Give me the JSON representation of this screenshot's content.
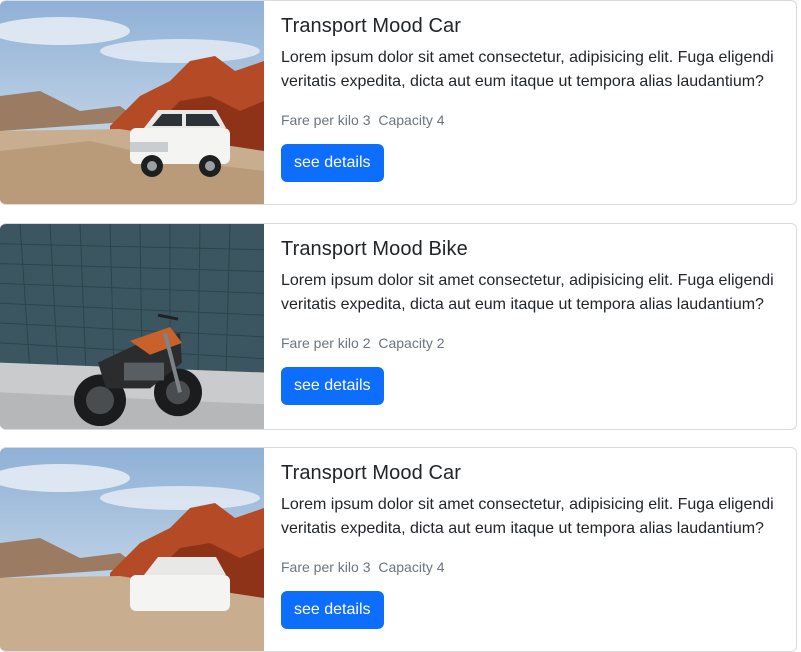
{
  "cards": [
    {
      "title": "Transport Mood Car",
      "description": "Lorem ipsum dolor sit amet consectetur, adipisicing elit. Fuga eligendi veritatis expedita, dicta aut eum itaque ut tempora alias laudantium?",
      "fare_label": "Fare per kilo 3",
      "capacity_label": "Capacity 4",
      "button_label": "see details",
      "image": "white-suv-desert-photo"
    },
    {
      "title": "Transport Mood Bike",
      "description": "Lorem ipsum dolor sit amet consectetur, adipisicing elit. Fuga eligendi veritatis expedita, dicta aut eum itaque ut tempora alias laudantium?",
      "fare_label": "Fare per kilo 2",
      "capacity_label": "Capacity 2",
      "button_label": "see details",
      "image": "motorcycle-tile-wall-photo"
    },
    {
      "title": "Transport Mood Car",
      "description": "Lorem ipsum dolor sit amet consectetur, adipisicing elit. Fuga eligendi veritatis expedita, dicta aut eum itaque ut tempora alias laudantium?",
      "fare_label": "Fare per kilo 3",
      "capacity_label": "Capacity 4",
      "button_label": "see details",
      "image": "white-suv-desert-photo"
    }
  ],
  "colors": {
    "primary": "#0d6efd",
    "muted": "#6c757d",
    "text": "#212529"
  }
}
